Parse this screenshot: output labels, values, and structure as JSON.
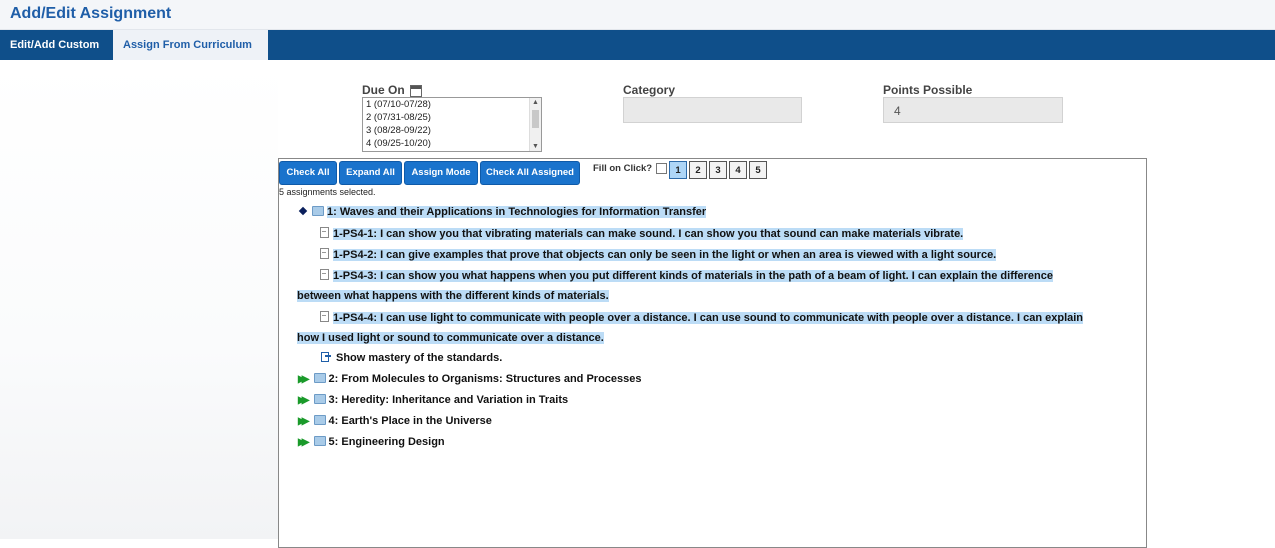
{
  "header": {
    "title": "Add/Edit Assignment"
  },
  "tabs": [
    {
      "label": "Edit/Add Custom"
    },
    {
      "label": "Assign From Curriculum"
    }
  ],
  "form": {
    "due_on_label": "Due On",
    "due_on_options": [
      "1 (07/10-07/28)",
      "2 (07/31-08/25)",
      "3 (08/28-09/22)",
      "4 (09/25-10/20)"
    ],
    "category_label": "Category",
    "category_value": "",
    "points_label": "Points Possible",
    "points_value": "4"
  },
  "toolbar": {
    "check_all": "Check All",
    "expand_all": "Expand All",
    "assign_mode": "Assign Mode",
    "check_all_assigned": "Check All Assigned",
    "fill_on_click": "Fill on Click?",
    "pages": [
      "1",
      "2",
      "3",
      "4",
      "5"
    ],
    "active_page": "1"
  },
  "selection_status": "5 assignments selected.",
  "tree": {
    "unit1": {
      "title": "1: Waves and their Applications in Technologies for Information Transfer",
      "standards": [
        {
          "line1": "1-PS4-1: I can show you that vibrating materials can make sound. I can show you that sound can make materials vibrate.",
          "line2": ""
        },
        {
          "line1": "1-PS4-2: I can give examples that prove that objects can only be seen in the light or when an area is viewed with a light source.",
          "line2": ""
        },
        {
          "line1": "1-PS4-3: I can show you what happens when you put different kinds of materials in the path of a beam of light. I can explain the difference",
          "line2": "between what happens with the different kinds of materials."
        },
        {
          "line1": "1-PS4-4: I can use light to communicate with people over a distance. I can use sound to communicate with people over a distance. I can explain",
          "line2": "how I used light or sound to communicate over a distance."
        }
      ],
      "mastery": "Show mastery of the standards."
    },
    "units": [
      "2: From Molecules to Organisms: Structures and Processes",
      "3: Heredity: Inheritance and Variation in Traits",
      "4: Earth's Place in the Universe",
      "5: Engineering Design"
    ]
  }
}
